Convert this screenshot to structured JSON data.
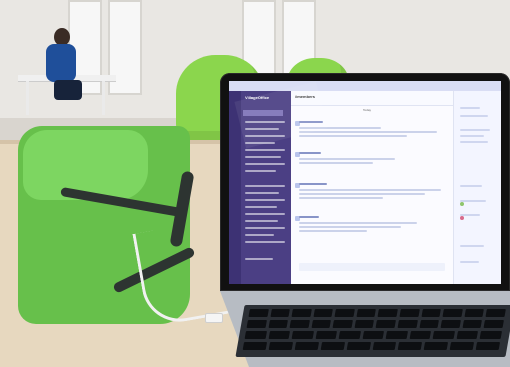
{
  "photo": {
    "slack": {
      "workspace": "VillageOffice",
      "channel": "#members",
      "date": "Today"
    }
  }
}
